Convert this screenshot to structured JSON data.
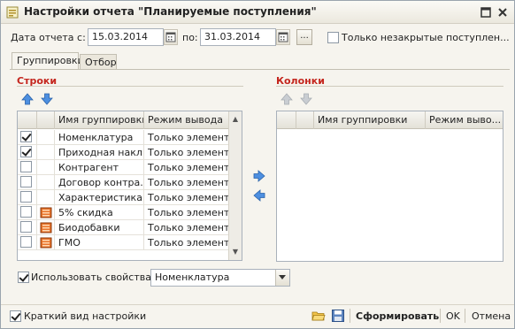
{
  "window": {
    "title": "Настройки отчета  \"Планируемые поступления\""
  },
  "header": {
    "date_from_label": "Дата отчета с:",
    "date_from_value": "15.03.2014",
    "date_to_label": "по:",
    "date_to_value": "31.03.2014",
    "period_button_label": "...",
    "only_open_label": "Только незакрытые поступлен...",
    "only_open_checked": false
  },
  "tabs": [
    {
      "label": "Группировки",
      "active": true
    },
    {
      "label": "Отбор",
      "active": false
    }
  ],
  "rows_section": {
    "title": "Строки",
    "columns": [
      "Имя группировки",
      "Режим вывода"
    ],
    "items": [
      {
        "checked": true,
        "icon": "",
        "name": "Номенклатура",
        "mode": "Только элементы"
      },
      {
        "checked": true,
        "icon": "",
        "name": "Приходная накл...",
        "mode": "Только элементы"
      },
      {
        "checked": false,
        "icon": "",
        "name": "Контрагент",
        "mode": "Только элементы"
      },
      {
        "checked": false,
        "icon": "",
        "name": "Договор контра...",
        "mode": "Только элементы"
      },
      {
        "checked": false,
        "icon": "",
        "name": "Характеристика...",
        "mode": "Только элементы"
      },
      {
        "checked": false,
        "icon": "property-icon",
        "name": "5% скидка",
        "mode": "Только элементы"
      },
      {
        "checked": false,
        "icon": "property-icon",
        "name": "Биодобавки",
        "mode": "Только элементы"
      },
      {
        "checked": false,
        "icon": "property-icon",
        "name": "ГМО",
        "mode": "Только элементы"
      }
    ],
    "use_properties_label": "Использовать свойства",
    "use_properties_checked": true,
    "properties_combo_value": "Номенклатура"
  },
  "columns_section": {
    "title": "Колонки",
    "columns": [
      "Имя группировки",
      "Режим выво..."
    ]
  },
  "footer": {
    "short_view_label": "Краткий вид настройки",
    "short_view_checked": true,
    "generate_label": "Сформировать",
    "ok_label": "OK",
    "cancel_label": "Отмена"
  },
  "colors": {
    "section_title": "#c4261e",
    "arrow_blue": "#3a7bd5"
  }
}
